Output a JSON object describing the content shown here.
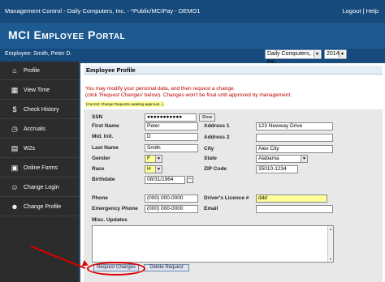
{
  "title_bar": {
    "text": "Management Control - Daily Computers, Inc. - *Public/MCIPay - DEMO1",
    "logout": "Logout",
    "separator": "|",
    "help": "Help"
  },
  "portal_title": "MCI Employee Portal",
  "user_bar": {
    "employee": "Employee: Smith, Peter D.",
    "company_select": "Daily Computers, Inc.",
    "year_select": "2014"
  },
  "sidebar": {
    "items": [
      {
        "label": "Profile",
        "icon": "home-icon"
      },
      {
        "label": "View Time",
        "icon": "calendar-icon"
      },
      {
        "label": "Check History",
        "icon": "dollar-icon"
      },
      {
        "label": "Accruals",
        "icon": "clock-icon"
      },
      {
        "label": "W2s",
        "icon": "document-icon"
      },
      {
        "label": "Online Forms",
        "icon": "form-icon"
      },
      {
        "label": "Change Login",
        "icon": "person-icon"
      },
      {
        "label": "Change Profile",
        "icon": "profile-icon"
      }
    ]
  },
  "panel": {
    "title": "Employee Profile",
    "message1": "You may modify your personal data, and then request a change.",
    "message2": "(click 'Request Changes' below). Changes won't be final until approved by management.",
    "pending_note": "(Current Change Requests awaiting approval...)"
  },
  "form": {
    "ssn_label": "SSN",
    "ssn_value": "●●●●●●●●●●●",
    "show_button": "Show",
    "first_name_label": "First Name",
    "first_name_value": "Peter",
    "mid_init_label": "Mid. Init.",
    "mid_init_value": "D",
    "last_name_label": "Last Name",
    "last_name_value": "Smith",
    "gender_label": "Gender",
    "gender_value": "F",
    "race_label": "Race",
    "race_value": "H",
    "birthdate_label": "Birthdate",
    "birthdate_value": "08/31/1964",
    "address1_label": "Address 1",
    "address1_value": "123 Newway Drive",
    "address2_label": "Address 2",
    "address2_value": "",
    "city_label": "City",
    "city_value": "Alex City",
    "state_label": "State",
    "state_value": "Alabama",
    "zip_label": "ZIP Code",
    "zip_value": "35010-1234",
    "phone_label": "Phone",
    "phone_value": "(000) 000-0000",
    "emergency_phone_label": "Emergency Phone",
    "emergency_phone_value": "(000) 000-0000",
    "license_label": "Driver's Licence #",
    "license_value": "ddd",
    "email_label": "Email",
    "email_value": "",
    "misc_label": "Misc. Updates",
    "request_button": "Request Changes",
    "delete_button": "Delete Request"
  },
  "colors": {
    "title_bar": "#164a7c",
    "portal_header": "#1d5a92",
    "sidebar": "#2c2c2c",
    "highlight_field": "#ffff99",
    "message_red": "#c00000",
    "annotation_red": "#dd0000"
  }
}
